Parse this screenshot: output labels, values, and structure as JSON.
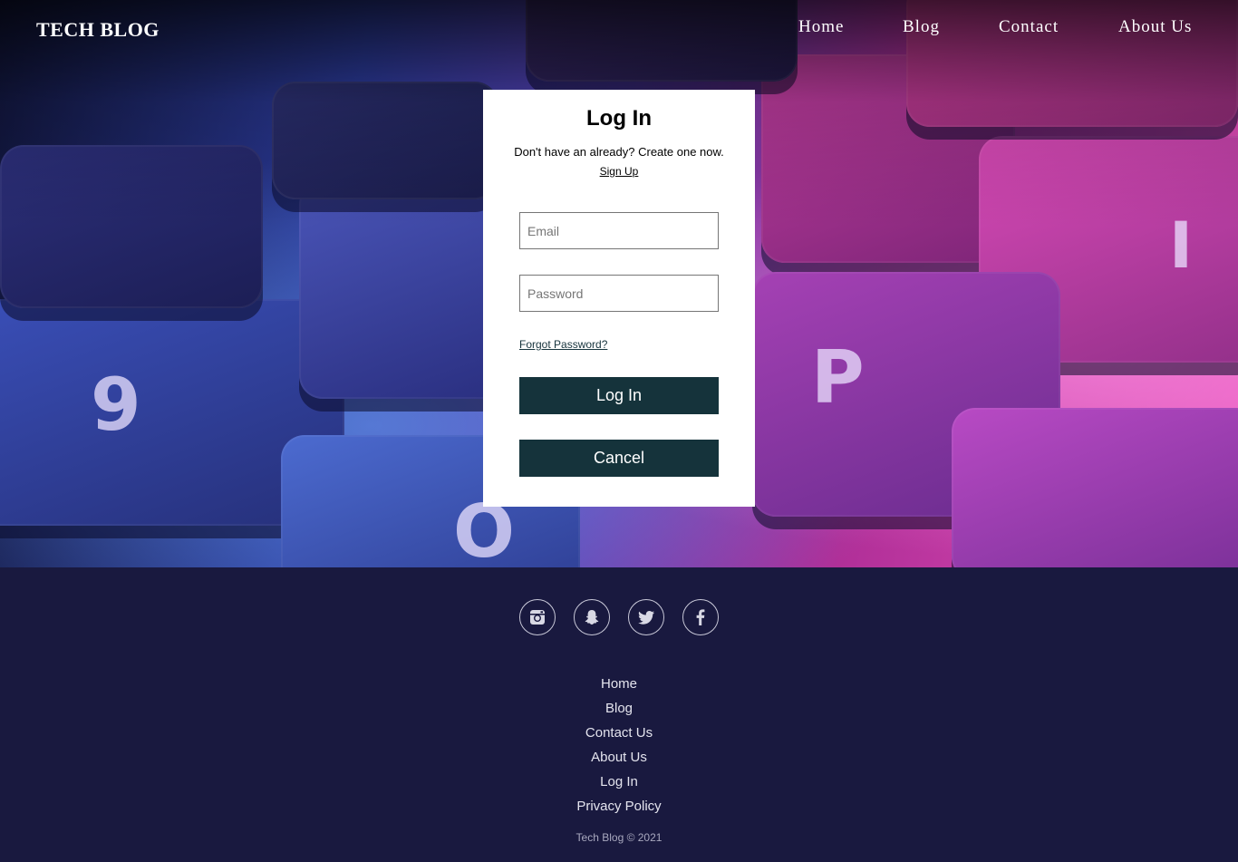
{
  "header": {
    "site_title": "TECH BLOG",
    "nav": [
      "Home",
      "Blog",
      "Contact",
      "About Us"
    ]
  },
  "login": {
    "title": "Log In",
    "subtitle": "Don't have an already? Create one now.",
    "signup_link": "Sign Up",
    "email_placeholder": "Email",
    "password_placeholder": "Password",
    "forgot_link": "Forgot Password?",
    "login_button": "Log In",
    "cancel_button": "Cancel"
  },
  "hero_keys": [
    "9",
    "O",
    "P",
    "I"
  ],
  "footer": {
    "social_icons": [
      "instagram-icon",
      "snapchat-icon",
      "twitter-icon",
      "facebook-icon"
    ],
    "links": [
      "Home",
      "Blog",
      "Contact Us",
      "About Us",
      "Log In",
      "Privacy Policy"
    ],
    "copyright": "Tech Blog © 2021"
  },
  "colors": {
    "button_bg": "#15333b",
    "footer_bg": "#19193f",
    "card_bg": "#ffffff"
  }
}
